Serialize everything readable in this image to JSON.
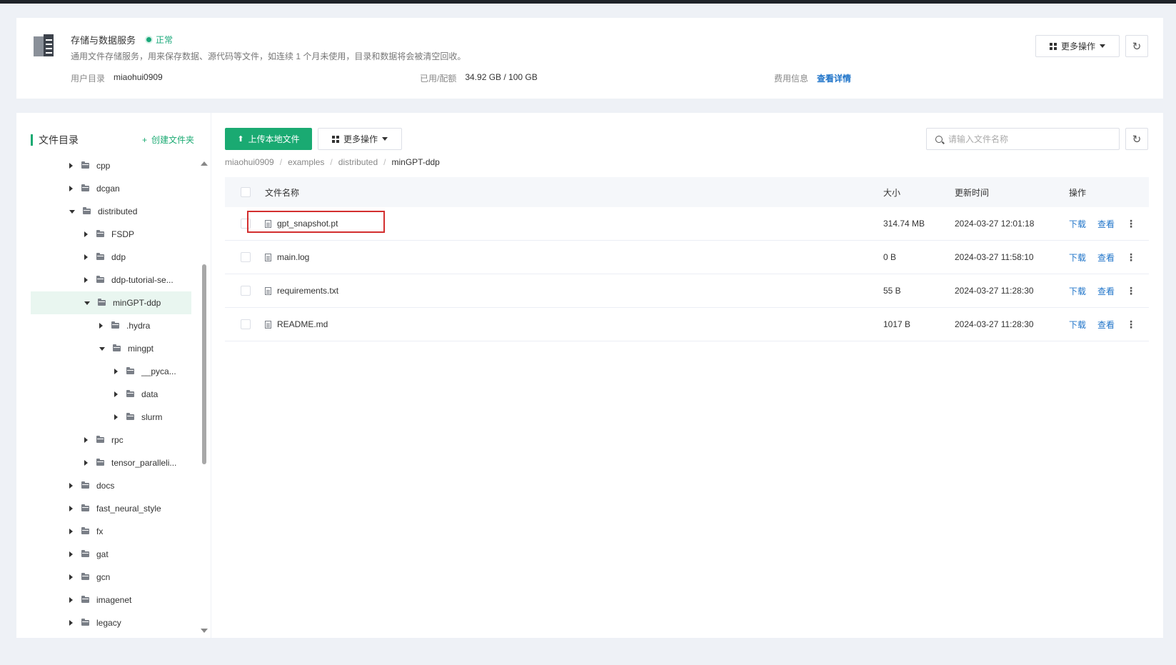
{
  "service": {
    "title": "存储与数据服务",
    "status": "正常",
    "description": "通用文件存储服务，用来保存数据、源代码等文件，如连续 1 个月未使用，目录和数据将会被清空回收。",
    "user_dir_label": "用户目录",
    "user_dir_value": "miaohui0909",
    "quota_label": "已用/配额",
    "quota_value": "34.92 GB / 100 GB",
    "billing_label": "费用信息",
    "billing_link": "查看详情",
    "more_ops": "更多操作"
  },
  "left": {
    "title": "文件目录",
    "create_folder": "创建文件夹",
    "tree": [
      {
        "label": "cpp",
        "level": 0,
        "expanded": false,
        "active": false
      },
      {
        "label": "dcgan",
        "level": 0,
        "expanded": false,
        "active": false
      },
      {
        "label": "distributed",
        "level": 0,
        "expanded": true,
        "active": false
      },
      {
        "label": "FSDP",
        "level": 1,
        "expanded": false,
        "active": false
      },
      {
        "label": "ddp",
        "level": 1,
        "expanded": false,
        "active": false
      },
      {
        "label": "ddp-tutorial-se...",
        "level": 1,
        "expanded": false,
        "active": false
      },
      {
        "label": "minGPT-ddp",
        "level": 1,
        "expanded": true,
        "active": true
      },
      {
        "label": ".hydra",
        "level": 2,
        "expanded": false,
        "active": false
      },
      {
        "label": "mingpt",
        "level": 2,
        "expanded": true,
        "active": false
      },
      {
        "label": "__pyca...",
        "level": 3,
        "expanded": false,
        "active": false
      },
      {
        "label": "data",
        "level": 3,
        "expanded": false,
        "active": false
      },
      {
        "label": "slurm",
        "level": 3,
        "expanded": false,
        "active": false
      },
      {
        "label": "rpc",
        "level": 1,
        "expanded": false,
        "active": false
      },
      {
        "label": "tensor_paralleli...",
        "level": 1,
        "expanded": false,
        "active": false
      },
      {
        "label": "docs",
        "level": 0,
        "expanded": false,
        "active": false
      },
      {
        "label": "fast_neural_style",
        "level": 0,
        "expanded": false,
        "active": false
      },
      {
        "label": "fx",
        "level": 0,
        "expanded": false,
        "active": false
      },
      {
        "label": "gat",
        "level": 0,
        "expanded": false,
        "active": false
      },
      {
        "label": "gcn",
        "level": 0,
        "expanded": false,
        "active": false
      },
      {
        "label": "imagenet",
        "level": 0,
        "expanded": false,
        "active": false
      },
      {
        "label": "legacy",
        "level": 0,
        "expanded": false,
        "active": false
      }
    ]
  },
  "toolbar": {
    "upload": "上传本地文件",
    "more_ops": "更多操作",
    "search_placeholder": "请输入文件名称"
  },
  "breadcrumb": [
    "miaohui0909",
    "examples",
    "distributed",
    "minGPT-ddp"
  ],
  "table": {
    "headers": {
      "name": "文件名称",
      "size": "大小",
      "time": "更新时间",
      "ops": "操作"
    },
    "download_label": "下载",
    "view_label": "查看",
    "rows": [
      {
        "name": "gpt_snapshot.pt",
        "size": "314.74 MB",
        "time": "2024-03-27 12:01:18",
        "highlighted": true
      },
      {
        "name": "main.log",
        "size": "0 B",
        "time": "2024-03-27 11:58:10",
        "highlighted": false
      },
      {
        "name": "requirements.txt",
        "size": "55 B",
        "time": "2024-03-27 11:28:30",
        "highlighted": false
      },
      {
        "name": "README.md",
        "size": "1017 B",
        "time": "2024-03-27 11:28:30",
        "highlighted": false
      }
    ]
  },
  "colors": {
    "accent": "#1aaa72",
    "link": "#1f74c9",
    "highlight": "#d32f2f"
  },
  "icons": {
    "refresh": "↻",
    "more": "⋮",
    "plus": "+",
    "upload": "⬆"
  }
}
